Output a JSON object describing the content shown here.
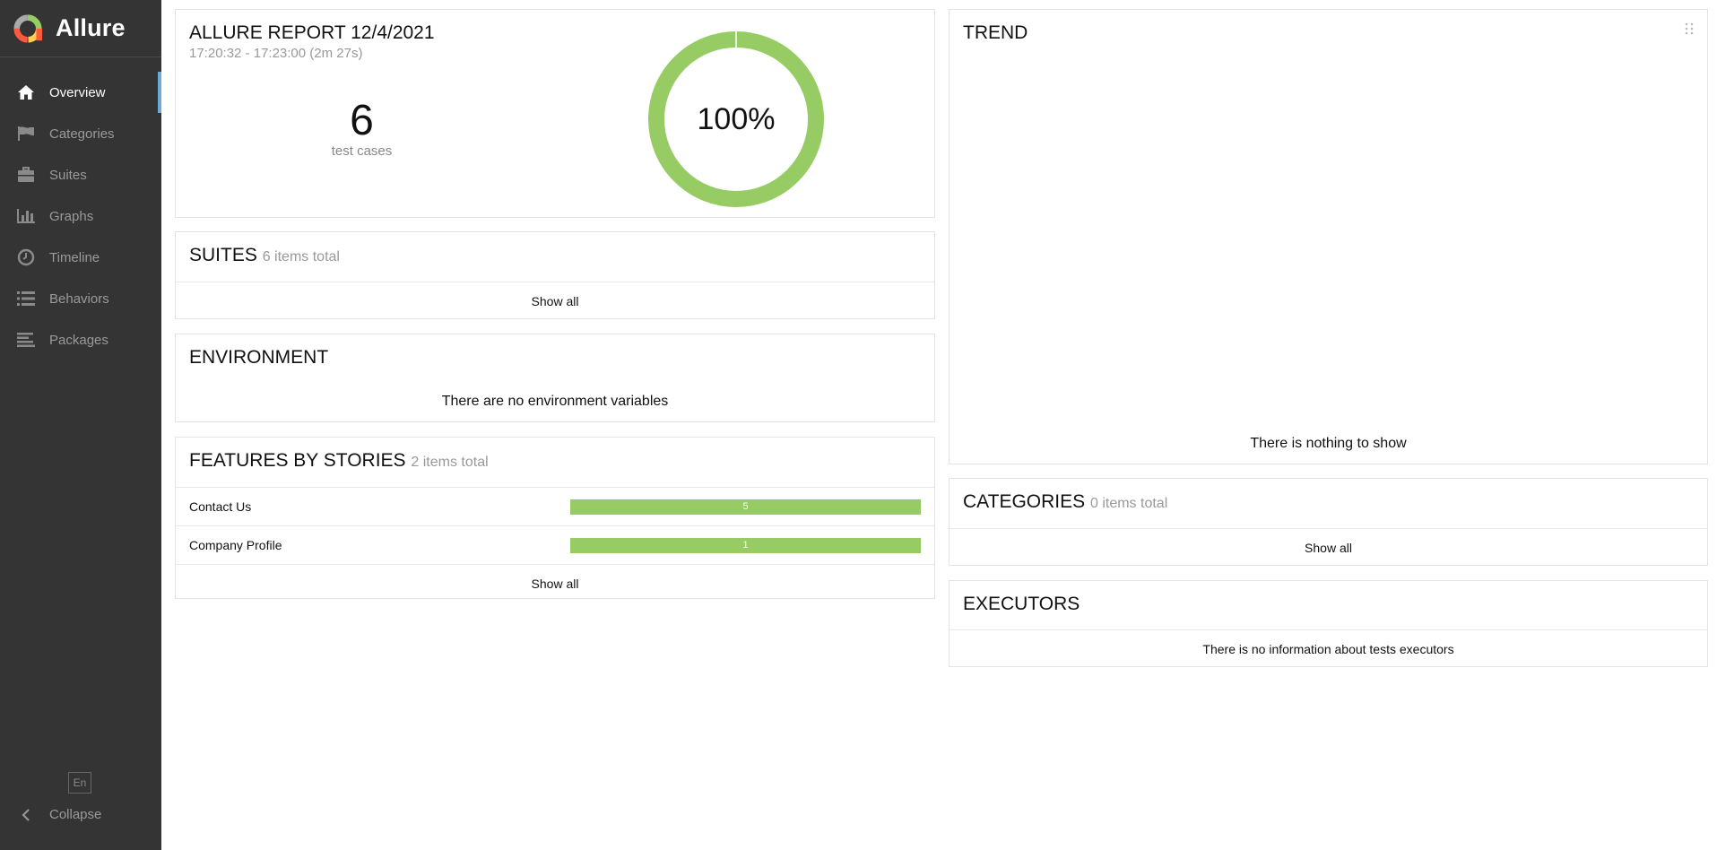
{
  "app": {
    "name": "Allure"
  },
  "sidebar": {
    "items": [
      {
        "label": "Overview",
        "icon": "home-icon",
        "active": true
      },
      {
        "label": "Categories",
        "icon": "flag-icon",
        "active": false
      },
      {
        "label": "Suites",
        "icon": "briefcase-icon",
        "active": false
      },
      {
        "label": "Graphs",
        "icon": "bar-chart-icon",
        "active": false
      },
      {
        "label": "Timeline",
        "icon": "clock-icon",
        "active": false
      },
      {
        "label": "Behaviors",
        "icon": "list-icon",
        "active": false
      },
      {
        "label": "Packages",
        "icon": "align-left-icon",
        "active": false
      }
    ],
    "language": "En",
    "collapse_label": "Collapse"
  },
  "summary": {
    "title": "ALLURE REPORT 12/4/2021",
    "time_range": "17:20:32 - 17:23:00 (2m 27s)",
    "count": "6",
    "count_label": "test cases",
    "success_rate": "100%",
    "pass_fraction": 1.0,
    "pass_color": "#97cc64"
  },
  "suites": {
    "title": "SUITES",
    "subtitle": "6 items total",
    "show_all": "Show all"
  },
  "environment": {
    "title": "ENVIRONMENT",
    "message": "There are no environment variables"
  },
  "features": {
    "title": "FEATURES BY STORIES",
    "subtitle": "2 items total",
    "rows": [
      {
        "label": "Contact Us",
        "value": "5"
      },
      {
        "label": "Company Profile",
        "value": "1"
      }
    ],
    "show_all": "Show all"
  },
  "trend": {
    "title": "TREND",
    "message": "There is nothing to show"
  },
  "categories": {
    "title": "CATEGORIES",
    "subtitle": "0 items total",
    "show_all": "Show all"
  },
  "executors": {
    "title": "EXECUTORS",
    "message": "There is no information about tests executors"
  }
}
